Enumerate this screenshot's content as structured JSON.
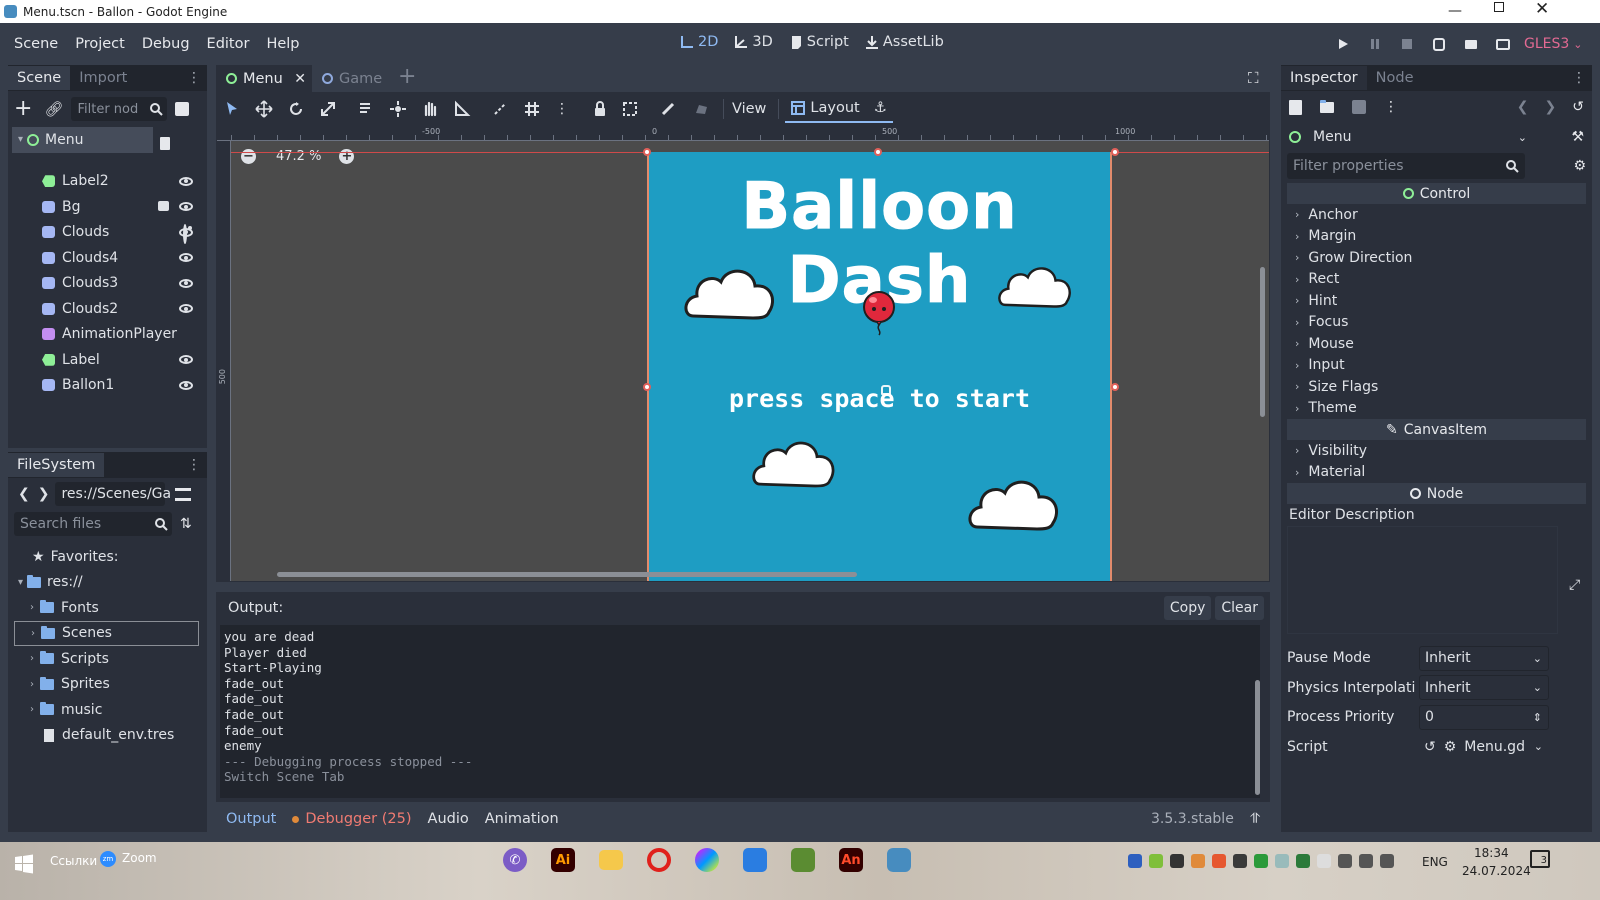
{
  "window": {
    "title": "Menu.tscn - Ballon - Godot Engine"
  },
  "menubar": {
    "items": [
      "Scene",
      "Project",
      "Debug",
      "Editor",
      "Help"
    ],
    "workspaces": [
      "2D",
      "3D",
      "Script",
      "AssetLib"
    ],
    "renderer": "GLES3"
  },
  "scene_dock": {
    "tabs": [
      "Scene",
      "Import"
    ],
    "filter_placeholder": "Filter nod",
    "tree": [
      {
        "name": "Menu",
        "type": "control"
      },
      {
        "name": "Label2",
        "type": "label"
      },
      {
        "name": "Bg",
        "type": "sprite"
      },
      {
        "name": "Clouds",
        "type": "sprite"
      },
      {
        "name": "Clouds4",
        "type": "sprite"
      },
      {
        "name": "Clouds3",
        "type": "sprite"
      },
      {
        "name": "Clouds2",
        "type": "sprite"
      },
      {
        "name": "AnimationPlayer",
        "type": "animation"
      },
      {
        "name": "Label",
        "type": "label"
      },
      {
        "name": "Ballon1",
        "type": "sprite"
      }
    ]
  },
  "filesystem": {
    "title": "FileSystem",
    "path": "res://Scenes/Ga",
    "search_placeholder": "Search files",
    "favorites": "Favorites:",
    "root": "res://",
    "folders": [
      "Fonts",
      "Scenes",
      "Scripts",
      "Sprites",
      "music"
    ],
    "files": [
      "default_env.tres"
    ]
  },
  "editor": {
    "tabs": [
      "Menu",
      "Game"
    ],
    "toolbar": {
      "view": "View",
      "layout": "Layout"
    },
    "zoom": "47.2 %",
    "ruler": {
      "top": [
        "-500",
        "0",
        "500",
        "1000"
      ],
      "left": [
        "500"
      ]
    },
    "game": {
      "title": "Balloon Dash",
      "subtitle": "press space to start",
      "bg_color": "#1e9dc3"
    }
  },
  "output": {
    "header": "Output:",
    "copy": "Copy",
    "clear": "Clear",
    "lines": [
      "you are dead",
      "Player died",
      "Start-Playing",
      "fade_out",
      "fade_out",
      "fade_out",
      "fade_out",
      "enemy"
    ],
    "dim_lines": [
      "--- Debugging process stopped ---",
      "Switch Scene Tab"
    ],
    "bottom_tabs": [
      "Output",
      "Debugger (25)",
      "Audio",
      "Animation"
    ],
    "version": "3.5.3.stable"
  },
  "inspector": {
    "tabs": [
      "Inspector",
      "Node"
    ],
    "node": "Menu",
    "filter_placeholder": "Filter properties",
    "control_section": "Control",
    "control_props": [
      "Anchor",
      "Margin",
      "Grow Direction",
      "Rect",
      "Hint",
      "Focus",
      "Mouse",
      "Input",
      "Size Flags",
      "Theme"
    ],
    "canvasitem_section": "CanvasItem",
    "canvasitem_props": [
      "Visibility",
      "Material"
    ],
    "node_section": "Node",
    "editor_description": "Editor Description",
    "props": [
      {
        "label": "Pause Mode",
        "value": "Inherit"
      },
      {
        "label": "Physics Interpolati",
        "value": "Inherit"
      },
      {
        "label": "Process Priority",
        "value": "0"
      },
      {
        "label": "Script",
        "value": "Menu.gd"
      }
    ]
  },
  "taskbar": {
    "search_label": "Ссылки",
    "zoom_label": "Zoom",
    "lang": "ENG",
    "time": "18:34",
    "date": "24.07.2024",
    "notifications": "3"
  }
}
